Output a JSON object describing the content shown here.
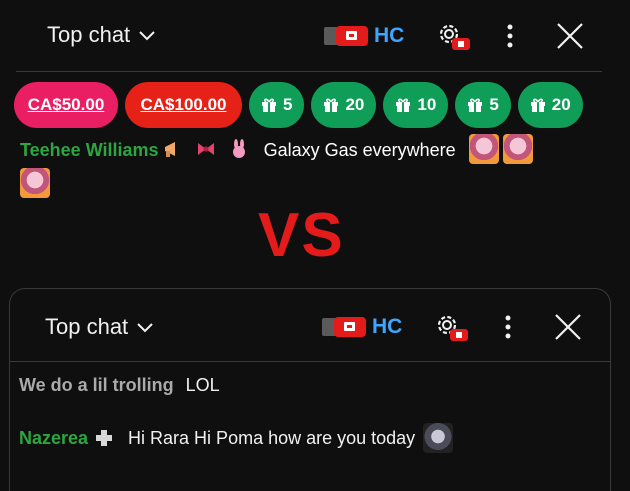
{
  "top_panel": {
    "title": "Top chat",
    "hc_label": "HC",
    "tickers": [
      {
        "label": "CA$50.00",
        "kind": "money",
        "color": "#e91e63"
      },
      {
        "label": "CA$100.00",
        "kind": "money",
        "color": "#e62117"
      },
      {
        "label": "5",
        "kind": "gift",
        "color": "#0f9d58"
      },
      {
        "label": "20",
        "kind": "gift",
        "color": "#0f9d58"
      },
      {
        "label": "10",
        "kind": "gift",
        "color": "#0f9d58"
      },
      {
        "label": "5",
        "kind": "gift",
        "color": "#0f9d58"
      },
      {
        "label": "20",
        "kind": "gift",
        "color": "#0f9d58"
      }
    ],
    "message": {
      "author": "Teehee Williams",
      "text": "Galaxy Gas everywhere"
    }
  },
  "separator_text": "VS",
  "bottom_panel": {
    "title": "Top chat",
    "hc_label": "HC",
    "messages": [
      {
        "author": "We do a lil trolling",
        "text": "LOL"
      },
      {
        "author": "Nazerea",
        "text": "Hi Rara Hi Poma how are you today"
      }
    ]
  },
  "colors": {
    "accent_blue": "#3ea6ff",
    "author_green": "#2ba640",
    "vs_red": "#e31b1b"
  }
}
